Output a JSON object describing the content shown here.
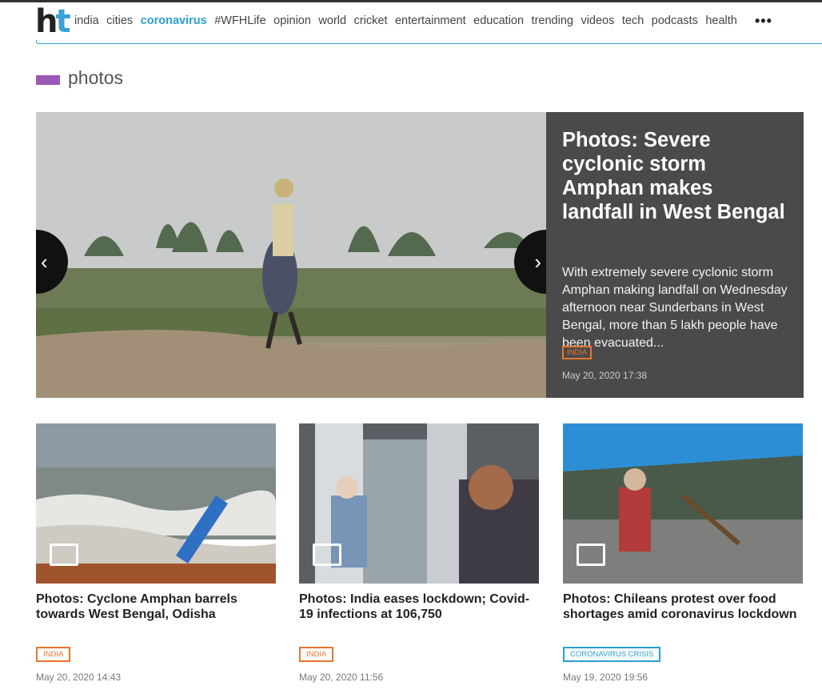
{
  "logo": {
    "h": "h",
    "t": "t"
  },
  "nav": [
    "india",
    "cities",
    "coronavirus",
    "#WFHLife",
    "opinion",
    "world",
    "cricket",
    "entertainment",
    "education",
    "trending",
    "videos",
    "tech",
    "podcasts",
    "health"
  ],
  "nav_active": "coronavirus",
  "more": "•••",
  "section": {
    "title": "photos",
    "color": "#9b59b6"
  },
  "hero": {
    "title": "Photos: Severe cyclonic storm Amphan makes landfall in West Bengal",
    "description": "With extremely severe cyclonic storm Amphan making landfall on Wednesday afternoon near Sunderbans in West Bengal, more than 5 lakh people have been evacuated...",
    "tag": "INDIA",
    "date": "May 20, 2020 17:38",
    "prev": "‹",
    "next": "›"
  },
  "cards": [
    {
      "title": "Photos: Cyclone Amphan barrels towards West Bengal, Odisha",
      "tag": "INDIA",
      "tag_color": "#e8762b",
      "date": "May 20, 2020 14:43"
    },
    {
      "title": "Photos: India eases lockdown; Covid-19 infections at 106,750",
      "tag": "INDIA",
      "tag_color": "#e8762b",
      "date": "May 20, 2020 11:56"
    },
    {
      "title": "Photos: Chileans protest over food shortages amid coronavirus lockdown",
      "tag": "CORONAVIRUS CRISIS",
      "tag_color": "#2b9fd4",
      "date": "May 19, 2020 19:56"
    }
  ]
}
